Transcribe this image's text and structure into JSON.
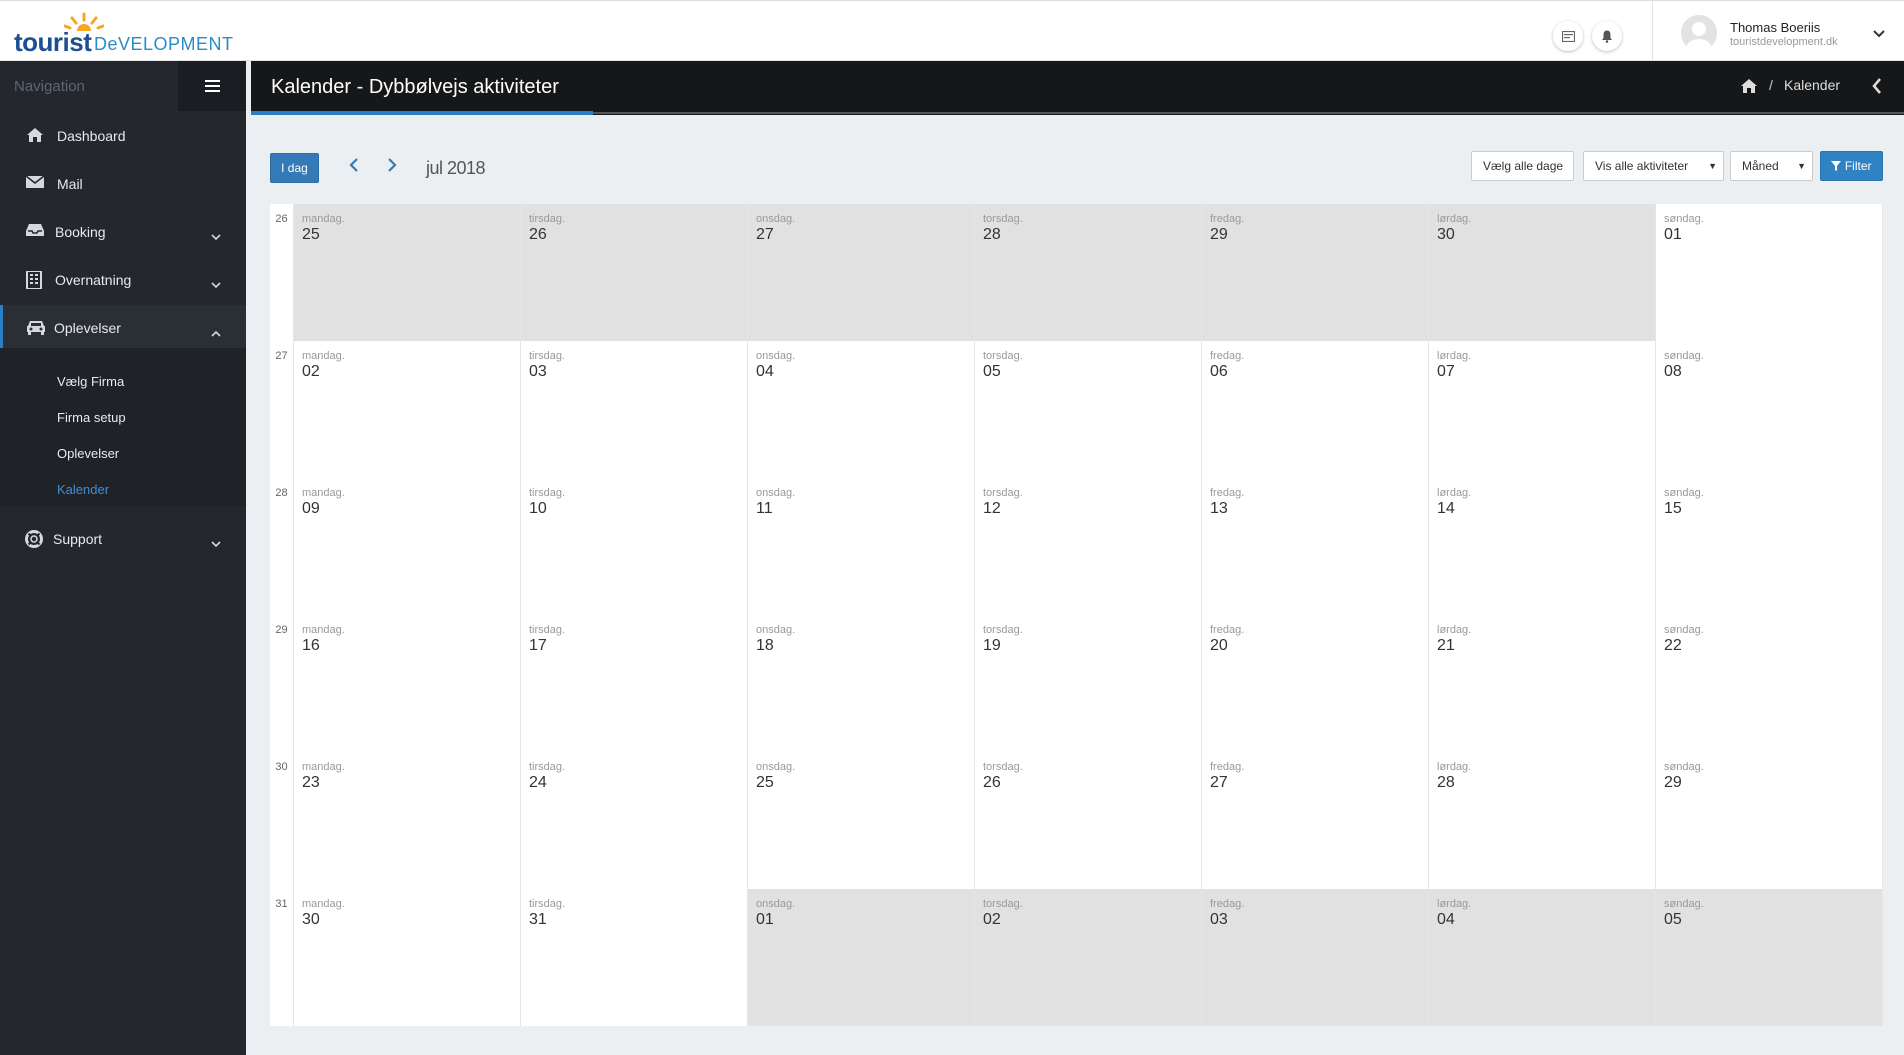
{
  "app": {
    "logo_word1": "tourist",
    "logo_word2": "DeVELOPMENT",
    "user_name": "Thomas Boeriis",
    "user_site": "touristdevelopment.dk"
  },
  "sidebar": {
    "title": "Navigation",
    "items": [
      {
        "label": "Dashboard",
        "icon": "home-icon",
        "chevron": false
      },
      {
        "label": "Mail",
        "icon": "envelope-icon",
        "chevron": false
      },
      {
        "label": "Booking",
        "icon": "inbox-icon",
        "chevron": true
      },
      {
        "label": "Overnatning",
        "icon": "building-icon",
        "chevron": true
      },
      {
        "label": "Oplevelser",
        "icon": "car-icon",
        "chevron": true,
        "active": true
      }
    ],
    "sub_items": [
      "Vælg Firma",
      "Firma setup",
      "Oplevelser",
      "Kalender"
    ],
    "support_label": "Support"
  },
  "header": {
    "page_title": "Kalender - Dybbølvejs aktiviteter",
    "breadcrumb_sep": "/",
    "breadcrumb_label": "Kalender"
  },
  "toolbar": {
    "today_label": "I dag",
    "month_label": "jul 2018",
    "select_days_label": "Vælg alle dage",
    "activities_value": "Vis alle aktiviteter",
    "view_value": "Måned",
    "filter_label": "Filter"
  },
  "calendar": {
    "day_names": [
      "mandag.",
      "tirsdag.",
      "onsdag.",
      "torsdag.",
      "fredag.",
      "lørdag.",
      "søndag."
    ],
    "weeks": [
      {
        "num": "26",
        "days": [
          "25",
          "26",
          "27",
          "28",
          "29",
          "30",
          "01"
        ],
        "other": [
          true,
          true,
          true,
          true,
          true,
          true,
          false
        ]
      },
      {
        "num": "27",
        "days": [
          "02",
          "03",
          "04",
          "05",
          "06",
          "07",
          "08"
        ],
        "other": [
          false,
          false,
          false,
          false,
          false,
          false,
          false
        ]
      },
      {
        "num": "28",
        "days": [
          "09",
          "10",
          "11",
          "12",
          "13",
          "14",
          "15"
        ],
        "other": [
          false,
          false,
          false,
          false,
          false,
          false,
          false
        ]
      },
      {
        "num": "29",
        "days": [
          "16",
          "17",
          "18",
          "19",
          "20",
          "21",
          "22"
        ],
        "other": [
          false,
          false,
          false,
          false,
          false,
          false,
          false
        ]
      },
      {
        "num": "30",
        "days": [
          "23",
          "24",
          "25",
          "26",
          "27",
          "28",
          "29"
        ],
        "other": [
          false,
          false,
          false,
          false,
          false,
          false,
          false
        ]
      },
      {
        "num": "31",
        "days": [
          "30",
          "31",
          "01",
          "02",
          "03",
          "04",
          "05"
        ],
        "other": [
          false,
          false,
          true,
          true,
          true,
          true,
          true
        ]
      }
    ]
  },
  "colors": {
    "accent": "#337ab7",
    "sidebar_bg": "#24282e",
    "title_bg": "#151719",
    "other_month_bg": "#e1e1e1"
  }
}
